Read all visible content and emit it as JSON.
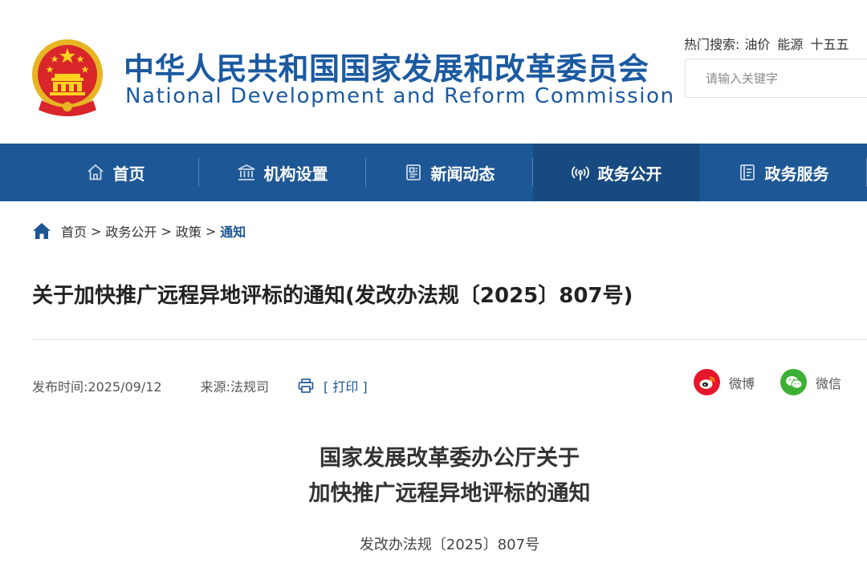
{
  "header": {
    "site_title_cn": "中华人民共和国国家发展和改革委员会",
    "site_title_en": "National Development and Reform Commission",
    "hot_search_label": "热门搜索:",
    "hot_search_terms": [
      "油价",
      "能源",
      "十五五"
    ],
    "search_placeholder": "请输入关键字"
  },
  "nav": {
    "items": [
      {
        "label": "首页",
        "icon": "home-icon"
      },
      {
        "label": "机构设置",
        "icon": "institution-icon"
      },
      {
        "label": "新闻动态",
        "icon": "news-icon"
      },
      {
        "label": "政务公开",
        "icon": "broadcast-icon",
        "active": true
      },
      {
        "label": "政务服务",
        "icon": "service-icon"
      }
    ]
  },
  "breadcrumb": {
    "items": [
      "首页",
      "政务公开",
      "政策"
    ],
    "separator": ">",
    "current": "通知"
  },
  "article": {
    "title": "关于加快推广远程异地评标的通知(发改办法规〔2025〕807号)",
    "publish_time": "发布时间:2025/09/12",
    "source": "来源:法规司",
    "print_label": "[ 打印 ]",
    "share_weibo": "微博",
    "share_wechat": "微信",
    "heading_line1": "国家发展改革委办公厅关于",
    "heading_line2": "加快推广远程异地评标的通知",
    "doc_number": "发改办法规〔2025〕807号"
  },
  "colors": {
    "brand_blue": "#1d5795",
    "nav_active": "#174a80",
    "weibo_red": "#e6162d",
    "wechat_green": "#3cb034"
  }
}
